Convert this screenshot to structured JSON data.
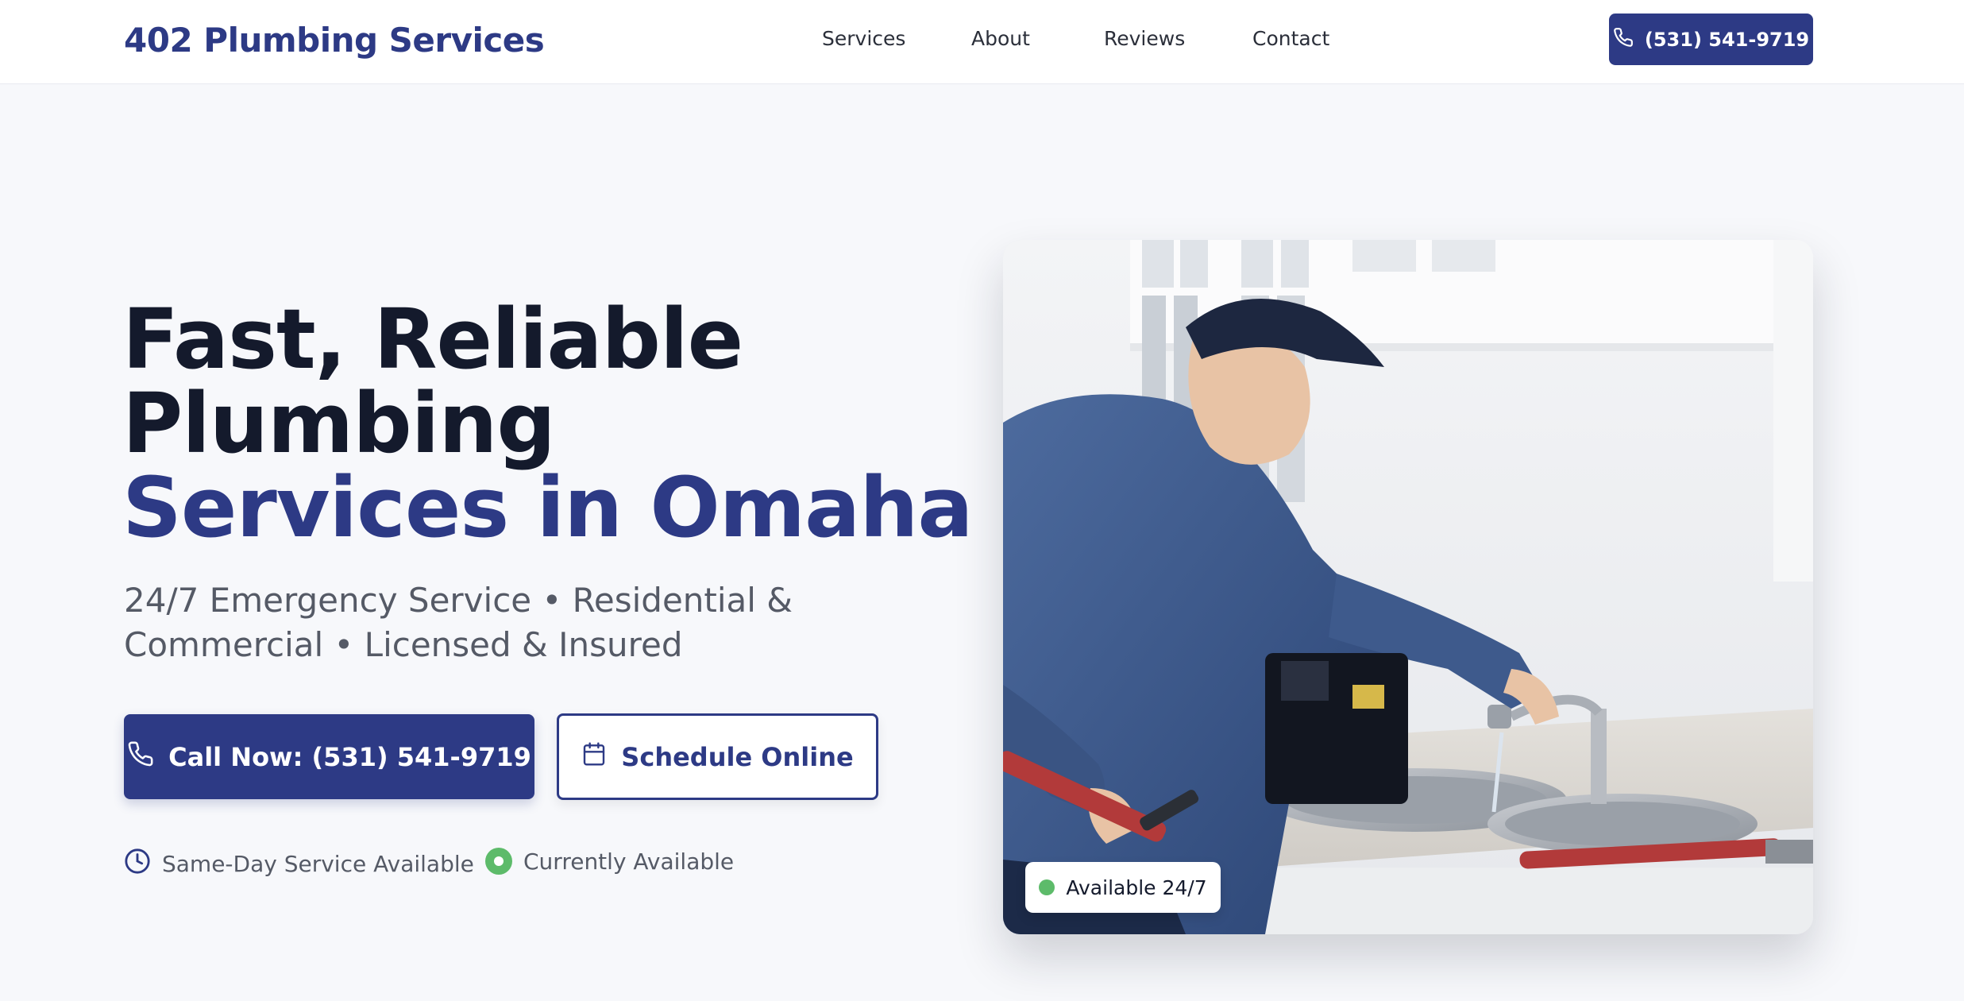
{
  "header": {
    "brand": "402 Plumbing Services",
    "nav": [
      {
        "label": "Services"
      },
      {
        "label": "About"
      },
      {
        "label": "Reviews"
      },
      {
        "label": "Contact"
      }
    ],
    "call_button": {
      "label": "(531) 541-9719",
      "icon": "phone-icon"
    }
  },
  "hero": {
    "title_line1": "Fast, Reliable",
    "title_line2": "Plumbing",
    "title_accent": "Services in Omaha",
    "subtitle": "24/7 Emergency Service • Residential & Commercial • Licensed & Insured",
    "primary_button": {
      "label": "Call Now: (531) 541-9719",
      "icon": "phone-icon"
    },
    "secondary_button": {
      "label": "Schedule Online",
      "icon": "calendar-icon"
    },
    "trust": [
      {
        "label": "Same-Day Service Available",
        "icon": "clock-icon"
      },
      {
        "label": "Currently Available",
        "icon": "status-dot-icon"
      }
    ]
  },
  "photo": {
    "badge": "Available 24/7"
  },
  "colors": {
    "brand": "#2d3a85",
    "text": "#141a2c",
    "muted": "#555a66",
    "available": "#5dbb6a",
    "background": "#f7f8fb"
  }
}
